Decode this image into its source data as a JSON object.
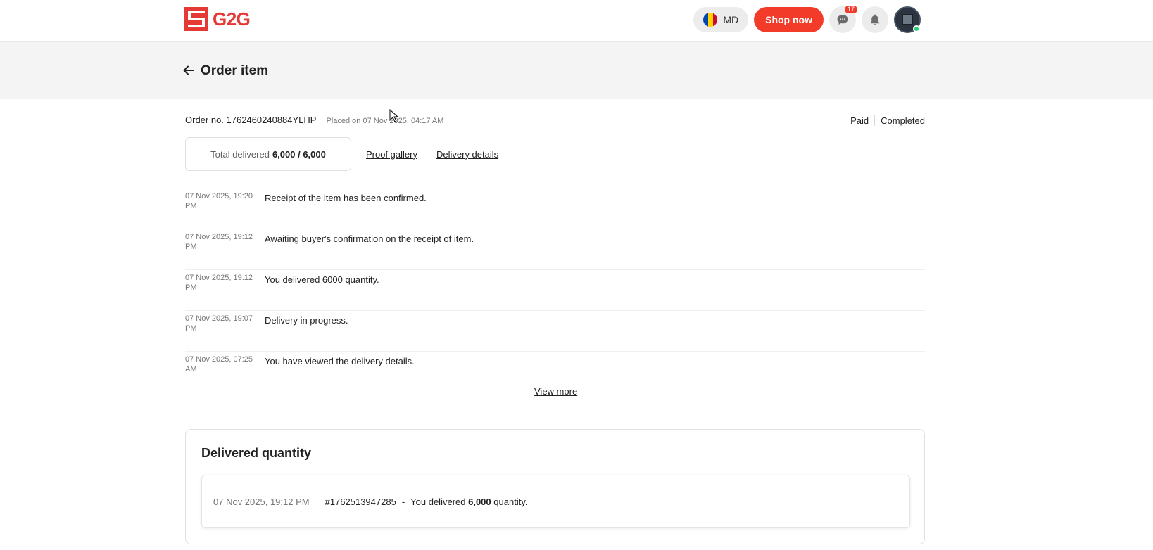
{
  "header": {
    "logo_text": "G2G",
    "logo_suffix": ".",
    "region_label": "MD",
    "shop_label": "Shop now",
    "chat_badge": "17",
    "brand_color": "#e53935",
    "accent_color": "#f33b2a",
    "icons": [
      "chat-icon",
      "bell-icon",
      "avatar"
    ]
  },
  "page": {
    "title": "Order item"
  },
  "order": {
    "number_label": "Order no. 1762460240884YLHP",
    "placed_label": "Placed on 07 Nov 2025, 04:17 AM",
    "status_paid": "Paid",
    "status_completed": "Completed",
    "total_delivered_label": "Total delivered",
    "total_delivered_value": "6,000 / 6,000",
    "proof_gallery_label": "Proof gallery",
    "delivery_details_label": "Delivery details"
  },
  "timeline": [
    {
      "time_line1": "07 Nov 2025, 19:20",
      "time_line2": "PM",
      "text": "Receipt of the item has been confirmed."
    },
    {
      "time_line1": "07 Nov 2025, 19:12",
      "time_line2": "PM",
      "text": "Awaiting buyer's confirmation on the receipt of item."
    },
    {
      "time_line1": "07 Nov 2025, 19:12",
      "time_line2": "PM",
      "text": "You delivered 6000 quantity."
    },
    {
      "time_line1": "07 Nov 2025, 19:07",
      "time_line2": "PM",
      "text": "Delivery in progress."
    },
    {
      "time_line1": "07 Nov 2025, 07:25",
      "time_line2": "AM",
      "text": "You have viewed the delivery details."
    }
  ],
  "view_more_label": "View more",
  "delivered_quantity": {
    "title": "Delivered quantity",
    "items": [
      {
        "time": "07 Nov 2025, 19:12 PM",
        "id": "#1762513947285",
        "dash": "-",
        "msg_prefix": "You delivered",
        "qty": "6,000",
        "msg_suffix": "quantity."
      }
    ]
  }
}
